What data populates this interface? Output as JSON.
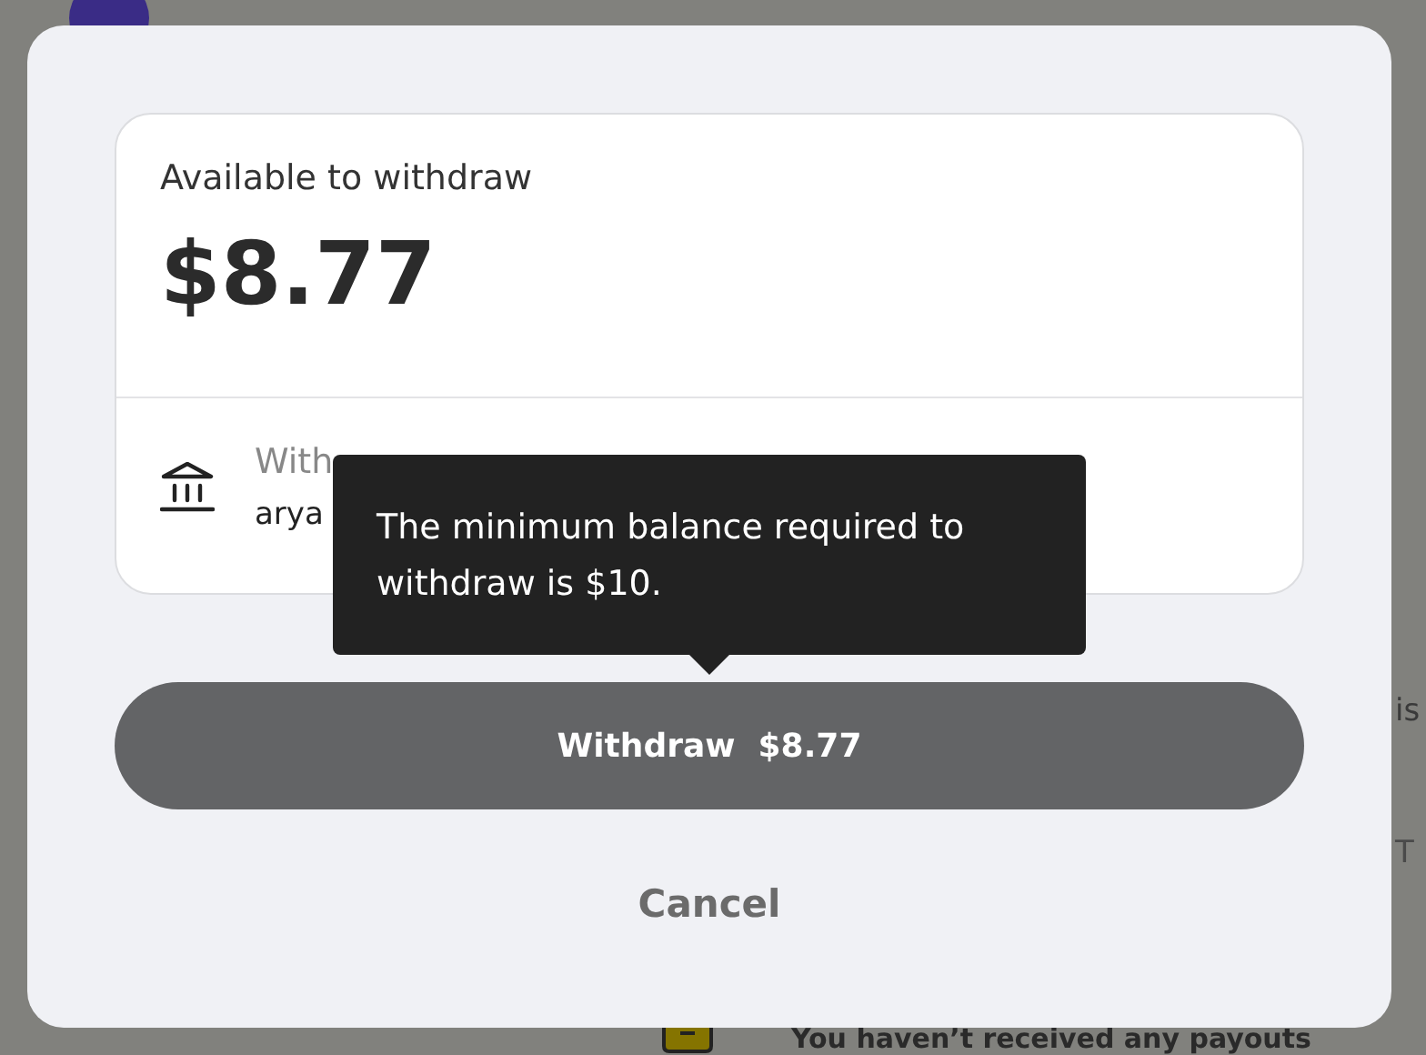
{
  "background": {
    "side_text": "is",
    "side_label": "T",
    "payouts_message": "You haven’t received any payouts"
  },
  "dialog": {
    "available_label": "Available to withdraw",
    "amount": "$8.77",
    "method_label": "With",
    "method_account": "arya",
    "tooltip": "The minimum balance required to withdraw is $10.",
    "withdraw_button": {
      "label": "Withdraw",
      "amount": "$8.77",
      "disabled": true
    },
    "cancel": "Cancel"
  }
}
